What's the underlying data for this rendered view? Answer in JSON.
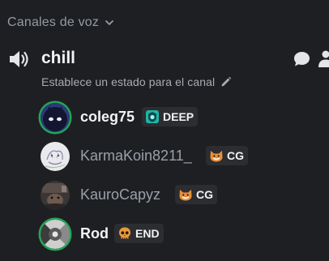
{
  "category": {
    "label": "Canales de voz",
    "icon": "chevron-down-icon"
  },
  "channel": {
    "name": "chill",
    "status_placeholder": "Establece un estado para el canal",
    "icons": [
      "speaker-icon",
      "chat-bubble-icon",
      "invite-user-icon",
      "pencil-icon"
    ]
  },
  "users": [
    {
      "name": "coleg75",
      "speaking": true,
      "tag": "DEEP",
      "tag_icon": "deep-badge-icon"
    },
    {
      "name": "KarmaKoin8211_",
      "speaking": false,
      "tag": "CG",
      "tag_icon": "cat-face-icon"
    },
    {
      "name": "KauroCapyz",
      "speaking": false,
      "tag": "CG",
      "tag_icon": "cat-face-icon"
    },
    {
      "name": "Rod",
      "speaking": true,
      "tag": "END",
      "tag_icon": "skull-icon"
    }
  ],
  "colors": {
    "background": "#1e1f22",
    "speaking_ring": "#23a55a",
    "tag_background": "#2b2d31",
    "deep_badge": "#1fb5a4",
    "cat_badge": "#e8903a",
    "skull_badge": "#e89a3c"
  }
}
